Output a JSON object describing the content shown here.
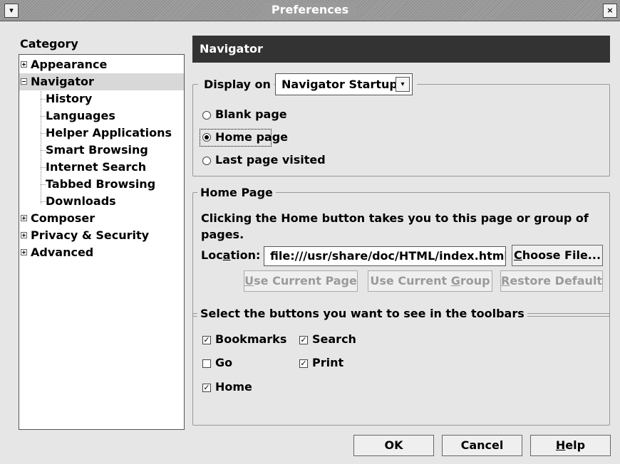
{
  "window": {
    "title": "Preferences"
  },
  "category": {
    "label": "Category",
    "items": [
      {
        "label": "Appearance",
        "expander": "plus"
      },
      {
        "label": "Navigator",
        "expander": "minus"
      },
      {
        "label": "History"
      },
      {
        "label": "Languages"
      },
      {
        "label": "Helper Applications"
      },
      {
        "label": "Smart Browsing"
      },
      {
        "label": "Internet Search"
      },
      {
        "label": "Tabbed Browsing"
      },
      {
        "label": "Downloads"
      },
      {
        "label": "Composer",
        "expander": "plus"
      },
      {
        "label": "Privacy & Security",
        "expander": "plus"
      },
      {
        "label": "Advanced",
        "expander": "plus"
      }
    ]
  },
  "panel": {
    "title": "Navigator"
  },
  "startup": {
    "display_on_label": "Display on",
    "display_on_value": "Navigator Startup",
    "options": [
      "Blank page",
      "Home page",
      "Last page visited"
    ],
    "selected": "Home page"
  },
  "homepage": {
    "legend": "Home Page",
    "description_line1": "Clicking the Home button takes you to this page or group of",
    "description_line2": "pages.",
    "location_label_pre": "Loc",
    "location_label_u": "a",
    "location_label_post": "tion:",
    "location_value": "file:///usr/share/doc/HTML/index.html",
    "choose_file_u": "C",
    "choose_file_rest": "hoose File...",
    "use_current_page_u": "U",
    "use_current_page_rest": "se Current Page",
    "use_current_group_pre": "Use Current ",
    "use_current_group_u": "G",
    "use_current_group_post": "roup",
    "restore_default_u": "R",
    "restore_default_rest": "estore Default"
  },
  "toolbars": {
    "legend": "Select the buttons you want to see in the toolbars",
    "bookmarks": {
      "label": "Bookmarks",
      "checked": true
    },
    "search": {
      "label": "Search",
      "checked": true
    },
    "go": {
      "label": "Go",
      "checked": false
    },
    "print": {
      "label": "Print",
      "checked": true
    },
    "home": {
      "label": "Home",
      "checked": true
    }
  },
  "footer": {
    "ok": "OK",
    "cancel": "Cancel",
    "help_u": "H",
    "help_rest": "elp"
  },
  "icons": {
    "checkmark": "✓",
    "collapse": "▾"
  }
}
